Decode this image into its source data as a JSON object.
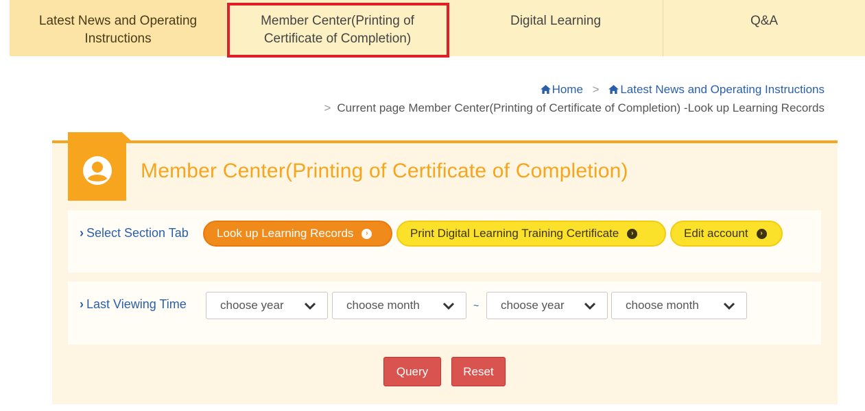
{
  "nav": {
    "tabs": [
      {
        "label": "Latest News and Operating\nInstructions"
      },
      {
        "label": "Member Center(Printing of\nCertificate of Completion)"
      },
      {
        "label": "Digital Learning"
      },
      {
        "label": "Q&A"
      }
    ]
  },
  "breadcrumb": {
    "home": "Home",
    "section": "Latest News and Operating Instructions",
    "separator": ">",
    "current_prefix": "Current page",
    "current": "Member Center(Printing of Certificate of Completion) -Look up Learning Records"
  },
  "panel": {
    "title": "Member Center(Printing of Certificate of Completion)",
    "select_section_label": "Select Section Tab",
    "section_tabs": [
      {
        "label": "Look up Learning Records",
        "active": true
      },
      {
        "label": "Print Digital Learning Training Certificate",
        "active": false
      },
      {
        "label": "Edit account",
        "active": false
      }
    ],
    "last_viewing_label": "Last Viewing Time",
    "range_separator": "~",
    "from_year_placeholder": "choose year",
    "from_month_placeholder": "choose month",
    "to_year_placeholder": "choose year",
    "to_month_placeholder": "choose month",
    "query_button": "Query",
    "reset_button": "Reset"
  },
  "colors": {
    "accent_orange": "#f7a41e",
    "active_pill": "#f08a1b",
    "yellow_pill": "#fbe12a",
    "action_red": "#d9534f",
    "highlight_red": "#e01f28",
    "link_blue": "#2a5fa8"
  }
}
